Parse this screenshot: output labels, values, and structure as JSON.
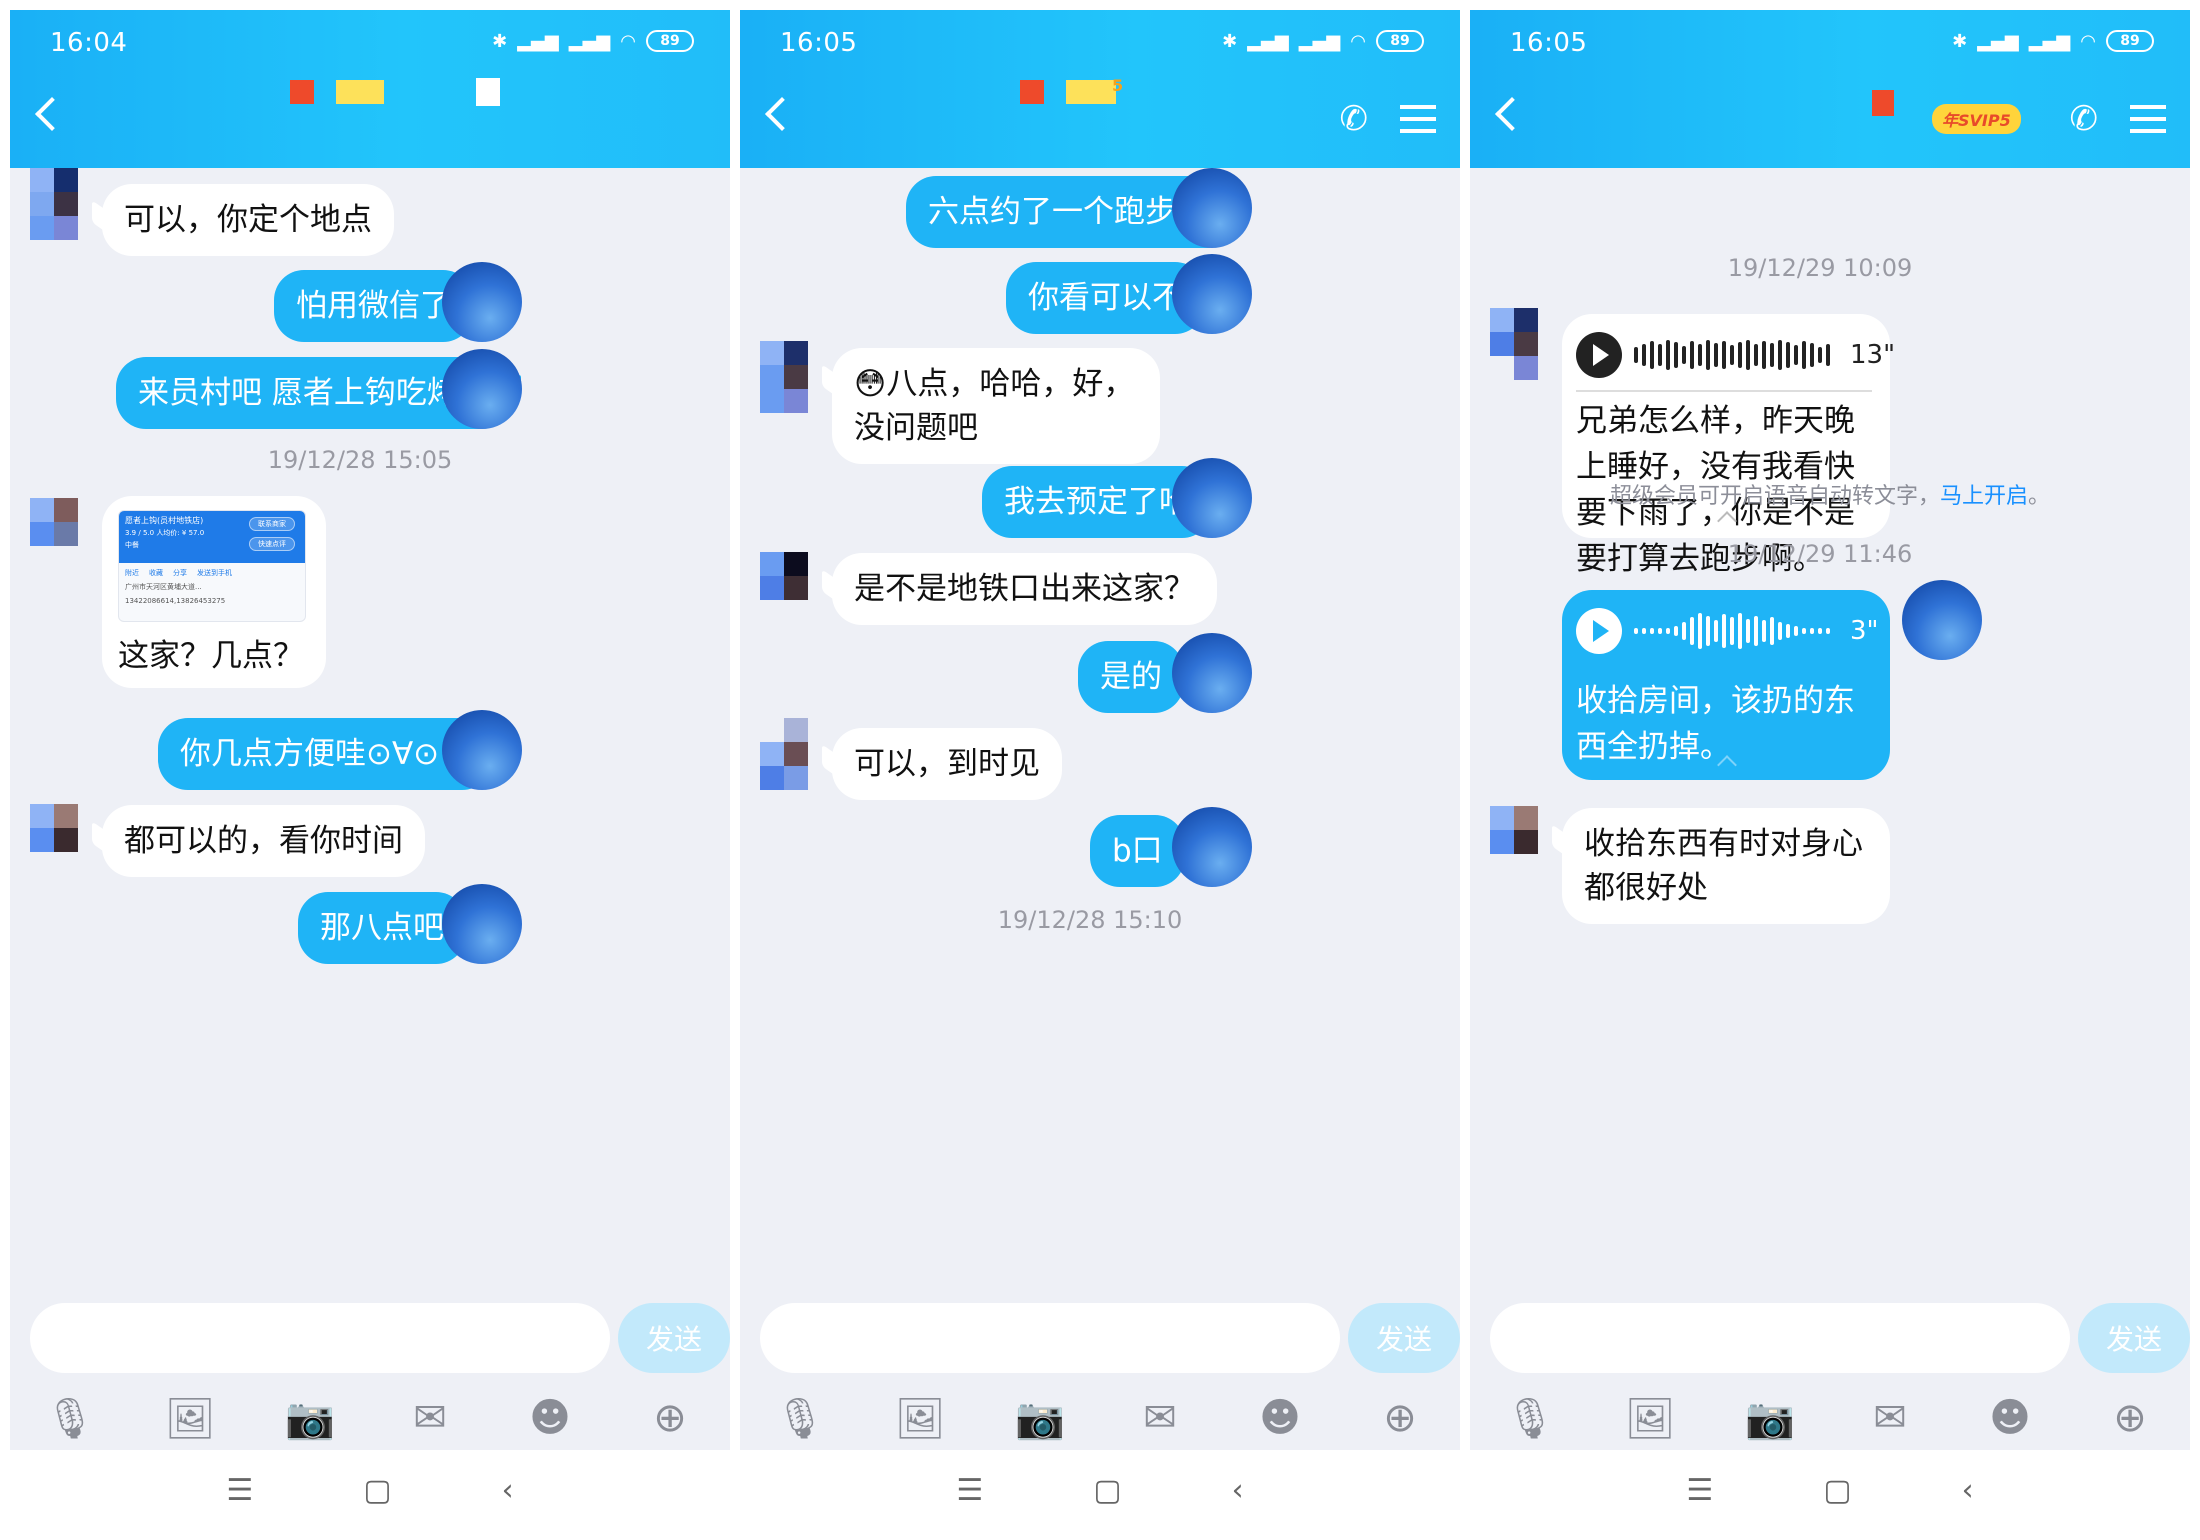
{
  "panels": [
    {
      "status": {
        "time": "16:04",
        "battery": "89"
      },
      "messages": [
        {
          "side": "left",
          "text": "可以，你定个地点"
        },
        {
          "side": "right",
          "text": "怕用微信了"
        },
        {
          "side": "right",
          "text": "来员村吧  愿者上钩吃烤鱼"
        },
        {
          "timestamp": "19/12/28 15:05"
        },
        {
          "side": "left",
          "card": {
            "shop_name": "愿者上钩(员村地铁店)",
            "rating": "3.9 / 5.0",
            "price": "人均价: ¥ 57.0",
            "tag": "中餐",
            "btn_call": "联系商家",
            "btn_review": "快速点评",
            "actions": [
              "附近",
              "收藏",
              "分享",
              "发送到手机"
            ],
            "address": "广州市天河区黄埔大道...",
            "phone": "13422086614,13826453275"
          },
          "text": "这家？几点？"
        },
        {
          "side": "right",
          "text": "你几点方便哇⊙∀⊙！"
        },
        {
          "side": "left",
          "text": "都可以的，看你时间"
        },
        {
          "side": "right",
          "text": "那八点吧"
        }
      ]
    },
    {
      "status": {
        "time": "16:05",
        "battery": "89"
      },
      "header_badge": "5",
      "messages": [
        {
          "side": "right",
          "text": "六点约了一个跑步🏃"
        },
        {
          "side": "right",
          "text": "你看可以不"
        },
        {
          "side": "left",
          "text": "😳八点，哈哈，好，没问题吧"
        },
        {
          "side": "right",
          "text": "我去预定了哈"
        },
        {
          "side": "left",
          "text": "是不是地铁口出来这家？"
        },
        {
          "side": "right",
          "text": "是的"
        },
        {
          "side": "left",
          "text": "可以，到时见"
        },
        {
          "side": "right",
          "text": "b口"
        },
        {
          "timestamp": "19/12/28 15:10"
        }
      ]
    },
    {
      "status": {
        "time": "16:05",
        "battery": "89"
      },
      "svip_badge": "年SVIP5",
      "messages": [
        {
          "timestamp": "19/12/29 10:09"
        },
        {
          "side": "left",
          "voice": {
            "duration": "13\"",
            "text": "兄弟怎么样，昨天晚上睡好，没有我看快要下雨了，你是不是要打算去跑步啊。"
          }
        },
        {
          "system": {
            "text": "超级会员可开启语音自动转文字，",
            "link": "马上开启",
            "suffix": "。"
          }
        },
        {
          "timestamp": "19/12/29 11:46"
        },
        {
          "side": "right",
          "voice": {
            "duration": "3\"",
            "text": "收拾房间，该扔的东西全扔掉。"
          }
        },
        {
          "side": "left",
          "text": "收拾东西有时对身心都很好处"
        }
      ]
    }
  ],
  "input": {
    "send_label": "发送",
    "placeholder": ""
  },
  "toolbar_icons": [
    "microphone-icon",
    "image-icon",
    "camera-icon",
    "red-packet-icon",
    "emoji-icon",
    "plus-icon"
  ],
  "nav_icons": [
    "menu-icon",
    "home-icon",
    "back-icon"
  ],
  "colors": {
    "header": "#1fb4f6",
    "bubble_me": "#1fb4f6",
    "chat_bg": "#eef0f6",
    "send_disabled": "#c2e9fb"
  }
}
